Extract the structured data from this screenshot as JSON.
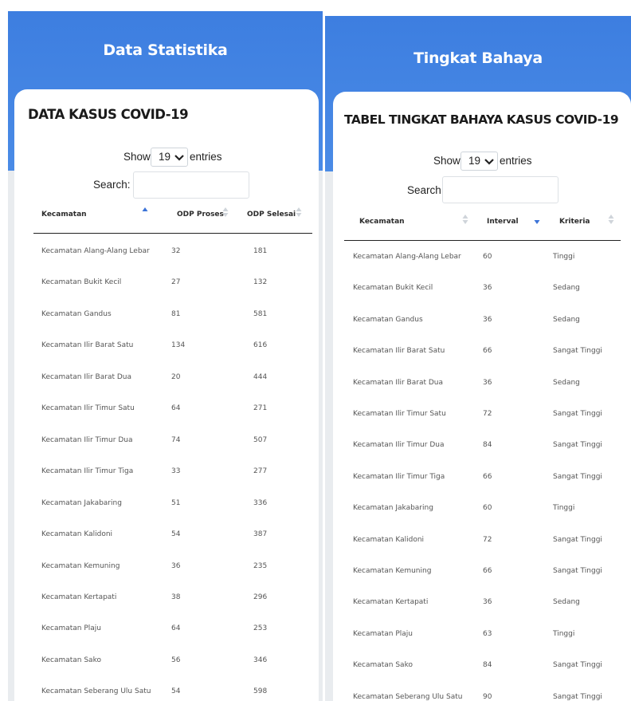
{
  "left": {
    "hero_title": "Data Statistika",
    "card_title": "DATA KASUS COVID-19",
    "show_label": "Show",
    "entries_value": "19",
    "entries_label": "entries",
    "search_label": "Search:",
    "search_value": "",
    "columns": [
      "Kecamatan",
      "ODP Proses",
      "ODP Selesai"
    ],
    "sort": {
      "column": "Kecamatan",
      "direction": "ascending"
    },
    "rows": [
      [
        "Kecamatan Alang-Alang Lebar",
        "32",
        "181"
      ],
      [
        "Kecamatan Bukit Kecil",
        "27",
        "132"
      ],
      [
        "Kecamatan Gandus",
        "81",
        "581"
      ],
      [
        "Kecamatan Ilir Barat Satu",
        "134",
        "616"
      ],
      [
        "Kecamatan Ilir Barat Dua",
        "20",
        "444"
      ],
      [
        "Kecamatan Ilir Timur Satu",
        "64",
        "271"
      ],
      [
        "Kecamatan Ilir Timur Dua",
        "74",
        "507"
      ],
      [
        "Kecamatan Ilir Timur Tiga",
        "33",
        "277"
      ],
      [
        "Kecamatan Jakabaring",
        "51",
        "336"
      ],
      [
        "Kecamatan Kalidoni",
        "54",
        "387"
      ],
      [
        "Kecamatan Kemuning",
        "36",
        "235"
      ],
      [
        "Kecamatan Kertapati",
        "38",
        "296"
      ],
      [
        "Kecamatan Plaju",
        "64",
        "253"
      ],
      [
        "Kecamatan Sako",
        "56",
        "346"
      ],
      [
        "Kecamatan Seberang Ulu Satu",
        "54",
        "598"
      ]
    ]
  },
  "right": {
    "hero_title": "Tingkat Bahaya",
    "card_title": "TABEL TINGKAT BAHAYA KASUS COVID-19",
    "show_label": "Show",
    "entries_value": "19",
    "entries_label": "entries",
    "search_label": "Search:",
    "search_value": "",
    "columns": [
      "Kecamatan",
      "Interval",
      "Kriteria"
    ],
    "sort": {
      "column": "Interval",
      "direction": "descending"
    },
    "rows": [
      [
        "Kecamatan Alang-Alang Lebar",
        "60",
        "Tinggi"
      ],
      [
        "Kecamatan Bukit Kecil",
        "36",
        "Sedang"
      ],
      [
        "Kecamatan Gandus",
        "36",
        "Sedang"
      ],
      [
        "Kecamatan Ilir Barat Satu",
        "66",
        "Sangat Tinggi"
      ],
      [
        "Kecamatan Ilir Barat Dua",
        "36",
        "Sedang"
      ],
      [
        "Kecamatan Ilir Timur Satu",
        "72",
        "Sangat Tinggi"
      ],
      [
        "Kecamatan Ilir Timur Dua",
        "84",
        "Sangat Tinggi"
      ],
      [
        "Kecamatan Ilir Timur Tiga",
        "66",
        "Sangat Tinggi"
      ],
      [
        "Kecamatan Jakabaring",
        "60",
        "Tinggi"
      ],
      [
        "Kecamatan Kalidoni",
        "72",
        "Sangat Tinggi"
      ],
      [
        "Kecamatan Kemuning",
        "66",
        "Sangat Tinggi"
      ],
      [
        "Kecamatan Kertapati",
        "36",
        "Sedang"
      ],
      [
        "Kecamatan Plaju",
        "63",
        "Tinggi"
      ],
      [
        "Kecamatan Sako",
        "84",
        "Sangat Tinggi"
      ],
      [
        "Kecamatan Seberang Ulu Satu",
        "90",
        "Sangat Tinggi"
      ]
    ]
  },
  "colors": {
    "header_blue": "#3d7ee0",
    "sort_active": "#3b73d8",
    "sort_inactive": "#cfd4da"
  }
}
